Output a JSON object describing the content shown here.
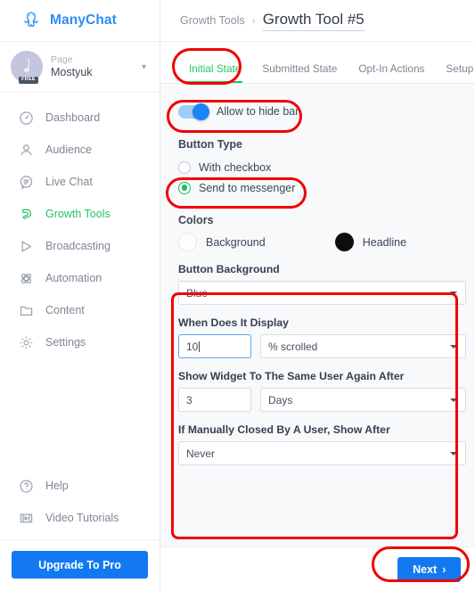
{
  "brand": {
    "name": "ManyChat",
    "logo_icon": "octopus-icon",
    "accent_blue": "#1279f2",
    "accent_green": "#22c463",
    "annotation_red": "#f00000"
  },
  "sidebar": {
    "account": {
      "label": "Page",
      "name": "Mostyuk",
      "badge": "FREE",
      "avatar_icon": "music-note-avatar",
      "chevron_icon": "chevron-down-icon"
    },
    "items": [
      {
        "label": "Dashboard",
        "icon": "gauge-icon",
        "active": false
      },
      {
        "label": "Audience",
        "icon": "user-icon",
        "active": false
      },
      {
        "label": "Live Chat",
        "icon": "chat-bubble-icon",
        "active": false
      },
      {
        "label": "Growth Tools",
        "icon": "magnet-icon",
        "active": true
      },
      {
        "label": "Broadcasting",
        "icon": "send-icon",
        "active": false
      },
      {
        "label": "Automation",
        "icon": "atom-icon",
        "active": false
      },
      {
        "label": "Content",
        "icon": "folder-icon",
        "active": false
      },
      {
        "label": "Settings",
        "icon": "gear-icon",
        "active": false
      }
    ],
    "bottom_items": [
      {
        "label": "Help",
        "icon": "question-circle-icon"
      },
      {
        "label": "Video Tutorials",
        "icon": "video-icon"
      }
    ],
    "upgrade_label": "Upgrade To Pro"
  },
  "header": {
    "breadcrumb_parent": "Growth Tools",
    "breadcrumb_separator": "›",
    "title": "Growth Tool #5"
  },
  "tabs": [
    {
      "label": "Initial State",
      "active": true
    },
    {
      "label": "Submitted State",
      "active": false
    },
    {
      "label": "Opt-In Actions",
      "active": false
    },
    {
      "label": "Setup",
      "active": false
    }
  ],
  "main": {
    "hide_bar_toggle": {
      "label": "Allow to hide bar",
      "state": "on"
    },
    "button_type": {
      "title": "Button Type",
      "options": [
        {
          "label": "With checkbox",
          "selected": false
        },
        {
          "label": "Send to messenger",
          "selected": true
        }
      ]
    },
    "colors": {
      "title": "Colors",
      "items": [
        {
          "label": "Background",
          "swatch": "#fdfdfd"
        },
        {
          "label": "Headline",
          "swatch": "#0d0d0d"
        }
      ]
    },
    "fields": {
      "button_background": {
        "label": "Button Background",
        "value": "Blue"
      },
      "when_display": {
        "label": "When Does It Display",
        "amount": "10",
        "unit": "% scrolled"
      },
      "show_again_after": {
        "label": "Show Widget To The Same User Again After",
        "amount": "3",
        "unit": "Days"
      },
      "if_closed_show_after": {
        "label": "If Manually Closed By A User, Show After",
        "value": "Never"
      }
    },
    "next_button": {
      "label": "Next",
      "icon": "chevron-right-icon"
    }
  }
}
